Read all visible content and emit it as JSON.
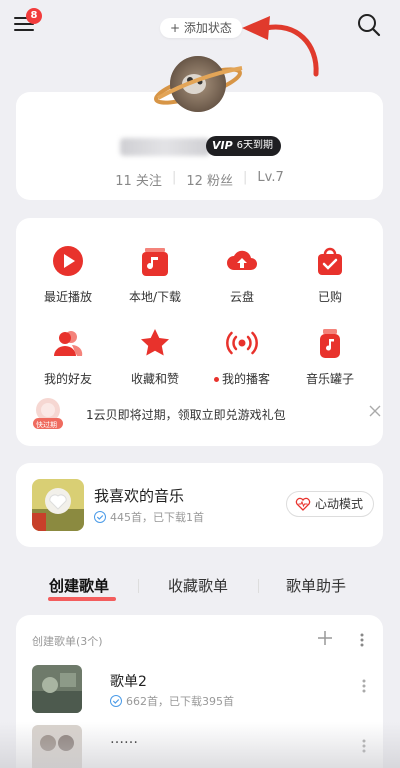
{
  "header": {
    "notification_count": "8",
    "add_status_label": "+ 添加状态"
  },
  "profile": {
    "vip_prefix": "VIP",
    "vip_expiry": "6天到期",
    "following": "11 关注",
    "followers": "12 粉丝",
    "level": "Lv.7"
  },
  "quick_grid": [
    {
      "label": "最近播放",
      "icon": "play-icon"
    },
    {
      "label": "本地/下载",
      "icon": "music-file-icon"
    },
    {
      "label": "云盘",
      "icon": "cloud-upload-icon"
    },
    {
      "label": "已购",
      "icon": "shopping-bag-icon"
    },
    {
      "label": "我的好友",
      "icon": "friends-icon"
    },
    {
      "label": "收藏和赞",
      "icon": "star-icon"
    },
    {
      "label": "我的播客",
      "icon": "podcast-icon"
    },
    {
      "label": "音乐罐子",
      "icon": "music-jar-icon"
    }
  ],
  "promo": {
    "badge": "快过期",
    "text": "1云贝即将过期，领取立即兑游戏礼包"
  },
  "favorite": {
    "title": "我喜欢的音乐",
    "subtitle": "445首，已下载1首",
    "heart_mode_label": "心动模式"
  },
  "tabs": [
    "创建歌单",
    "收藏歌单",
    "歌单助手"
  ],
  "playlists": {
    "header": "创建歌单(3个)",
    "items": [
      {
        "title": "歌单2",
        "subtitle": "662首，已下载395首"
      },
      {
        "title": "……",
        "subtitle": ""
      }
    ]
  },
  "colors": {
    "accent": "#e8322c",
    "background": "#efeff3"
  }
}
